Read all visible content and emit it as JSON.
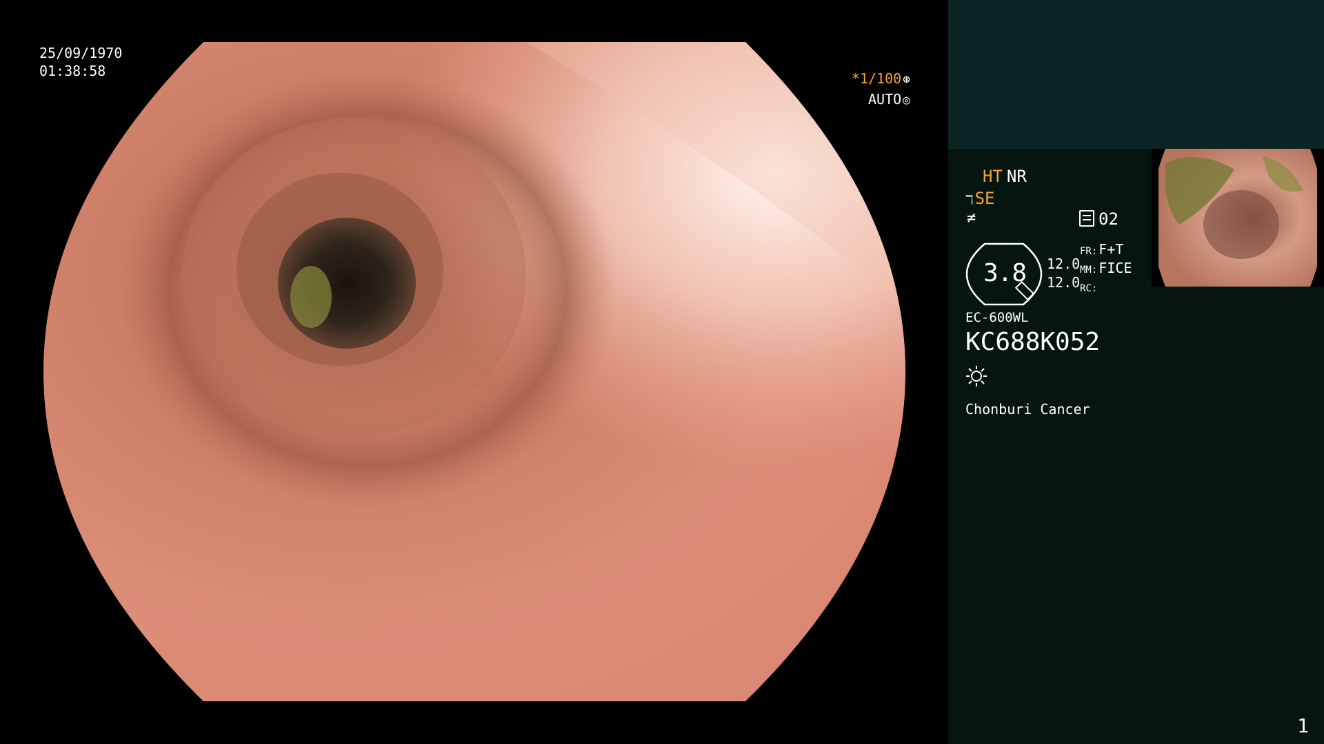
{
  "overlay": {
    "date": "25/09/1970",
    "time": "01:38:58",
    "shutter": "*1/100",
    "iris_mode": "AUTO"
  },
  "settings": {
    "ht": "HT",
    "nr": "NR",
    "se": "SE",
    "memo_number": "02",
    "gauge_value": "3.8",
    "value_1": "12.0",
    "value_2": "12.0",
    "fr_label": "FR:",
    "fr_value": "F+T",
    "mm_label": "MM:",
    "mm_value": "FICE",
    "rc_label": "RC:",
    "rc_value": ""
  },
  "scope": {
    "model": "EC-600WL",
    "serial": "KC688K052"
  },
  "hospital": "Chonburi Cancer",
  "page_number": "1",
  "colors": {
    "accent": "#f3a432",
    "panel_bg": "#071511",
    "panel_band": "#0c2424"
  },
  "icons": {
    "shutter": "aperture-icon",
    "iris": "iris-icon",
    "structure_enhance": "structure-enhance-icon",
    "noise_filter": "noise-filter-icon",
    "memo": "memo-icon",
    "light": "light-source-icon"
  }
}
